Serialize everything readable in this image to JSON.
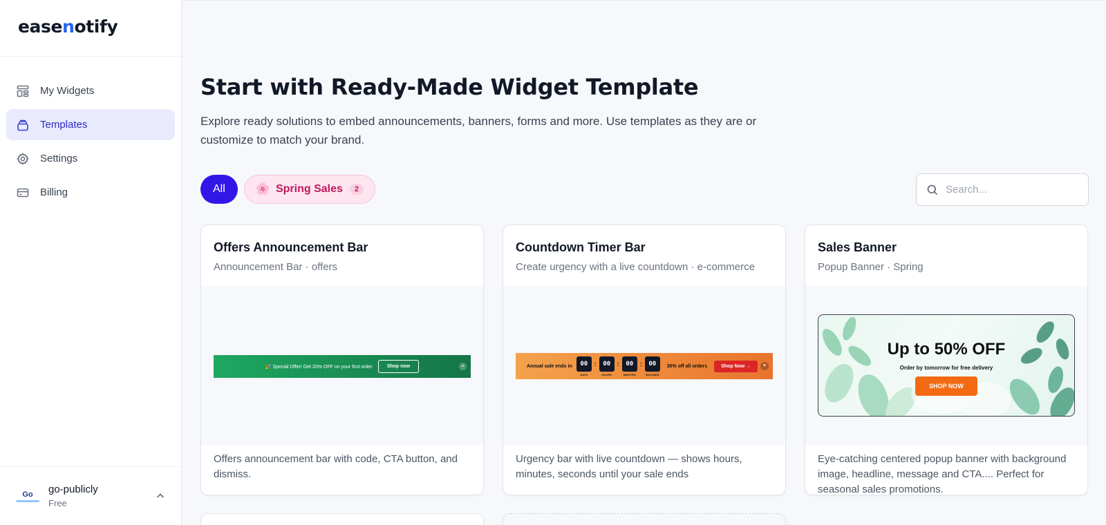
{
  "brand": {
    "logo_prefix": "ease",
    "logo_accent": "n",
    "logo_suffix": "otify",
    "accent_color": "#2563eb"
  },
  "sidebar": {
    "items": [
      {
        "label": "My Widgets",
        "icon": "layout-icon",
        "active": false
      },
      {
        "label": "Templates",
        "icon": "stack-icon",
        "active": true
      },
      {
        "label": "Settings",
        "icon": "gear-icon",
        "active": false
      },
      {
        "label": "Billing",
        "icon": "card-icon",
        "active": false
      }
    ],
    "account": {
      "name": "go-publicly",
      "plan": "Free",
      "avatar_text": "Go"
    }
  },
  "main": {
    "title": "Start with Ready-Made Widget Template",
    "subtitle": "Explore ready solutions to embed announcements, banners, forms and more. Use templates as they are or customize to match your brand.",
    "filters": {
      "all_label": "All",
      "spring_label": "Spring Sales",
      "spring_count": "2",
      "spring_emoji": "🌸"
    },
    "search": {
      "placeholder": "Search..."
    },
    "cards": [
      {
        "title": "Offers Announcement Bar",
        "meta": "Announcement Bar · offers",
        "description": "Offers announcement bar with code, CTA button, and dismiss.",
        "preview": {
          "text": "🎉 Special Offer! Get 20% OFF on your first order",
          "button": "Shop now",
          "close": "×"
        }
      },
      {
        "title": "Countdown Timer Bar",
        "meta": "Create urgency with a live countdown · e-commerce",
        "description": "Urgency bar with live countdown — shows hours, minutes, seconds until your sale ends",
        "preview": {
          "label": "Annual sale ends in",
          "units": [
            {
              "value": "00",
              "caption": "DAYS"
            },
            {
              "value": "00",
              "caption": "HOURS"
            },
            {
              "value": "00",
              "caption": "MINUTES"
            },
            {
              "value": "00",
              "caption": "SECONDS"
            }
          ],
          "separator": ":",
          "offer": "30% off all orders",
          "button": "Shop Now →",
          "close": "×"
        }
      },
      {
        "title": "Sales Banner",
        "meta": "Popup Banner · Spring",
        "description": "Eye-catching centered popup banner with background image, headline, message and CTA.... Perfect for seasonal sales promotions.",
        "preview": {
          "headline": "Up to 50% OFF",
          "message": "Order by tomorrow for free delivery",
          "button": "SHOP NOW"
        }
      }
    ]
  }
}
